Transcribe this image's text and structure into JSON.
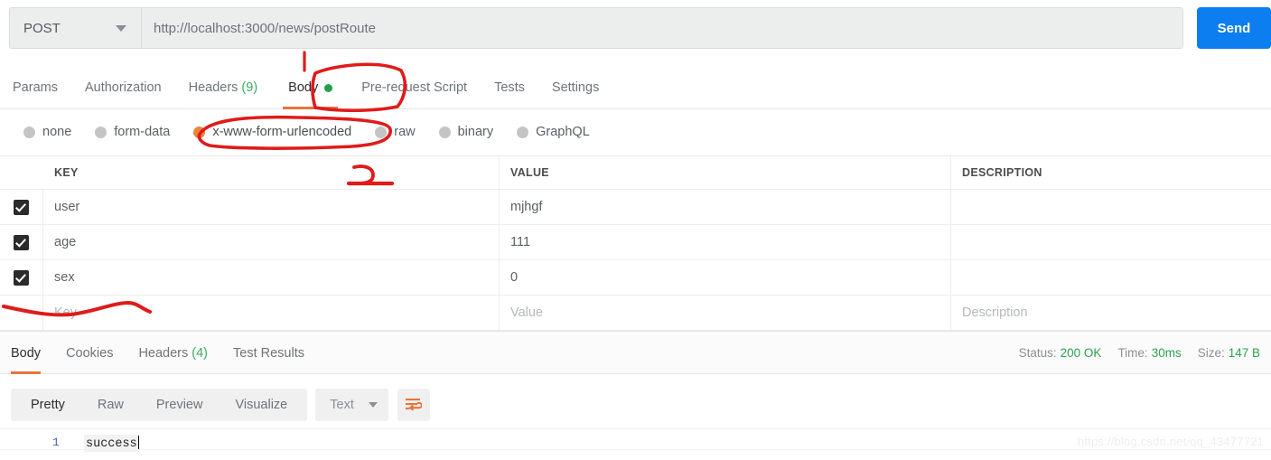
{
  "request": {
    "method": "POST",
    "url": "http://localhost:3000/news/postRoute",
    "send_label": "Send",
    "tabs": [
      {
        "label": "Params",
        "active": false
      },
      {
        "label": "Authorization",
        "active": false
      },
      {
        "label": "Headers",
        "count": "(9)",
        "active": false
      },
      {
        "label": "Body",
        "active": true,
        "dot": true
      },
      {
        "label": "Pre-request Script",
        "active": false
      },
      {
        "label": "Tests",
        "active": false
      },
      {
        "label": "Settings",
        "active": false
      }
    ],
    "body_types": [
      {
        "label": "none",
        "selected": false
      },
      {
        "label": "form-data",
        "selected": false
      },
      {
        "label": "x-www-form-urlencoded",
        "selected": true
      },
      {
        "label": "raw",
        "selected": false
      },
      {
        "label": "binary",
        "selected": false
      },
      {
        "label": "GraphQL",
        "selected": false
      }
    ],
    "table": {
      "headers": {
        "key": "KEY",
        "value": "VALUE",
        "description": "DESCRIPTION"
      },
      "rows": [
        {
          "checked": true,
          "key": "user",
          "value": "mjhgf",
          "description": ""
        },
        {
          "checked": true,
          "key": "age",
          "value": "111",
          "description": ""
        },
        {
          "checked": true,
          "key": "sex",
          "value": "0",
          "description": ""
        }
      ],
      "placeholder_row": {
        "key": "Key",
        "value": "Value",
        "description": "Description"
      }
    }
  },
  "response": {
    "tabs": [
      {
        "label": "Body",
        "active": true
      },
      {
        "label": "Cookies",
        "active": false
      },
      {
        "label": "Headers",
        "count": "(4)",
        "active": false
      },
      {
        "label": "Test Results",
        "active": false
      }
    ],
    "meta": {
      "status_label": "Status:",
      "status_value": "200 OK",
      "time_label": "Time:",
      "time_value": "30ms",
      "size_label": "Size:",
      "size_value": "147 B"
    },
    "viewer": {
      "modes": [
        {
          "label": "Pretty",
          "active": true
        },
        {
          "label": "Raw",
          "active": false
        },
        {
          "label": "Preview",
          "active": false
        },
        {
          "label": "Visualize",
          "active": false
        }
      ],
      "format": "Text",
      "wrap_icon": "word-wrap-icon"
    },
    "body": {
      "line_number": "1",
      "content": "success"
    }
  },
  "watermark": "https://blog.csdn.net/qq_43477721",
  "colors": {
    "accent_orange": "#e8743b",
    "send_blue": "#0d7ef0",
    "status_green": "#2fa14f",
    "annotation_red": "#e01b1b",
    "radio_selected": "#e8863b"
  }
}
